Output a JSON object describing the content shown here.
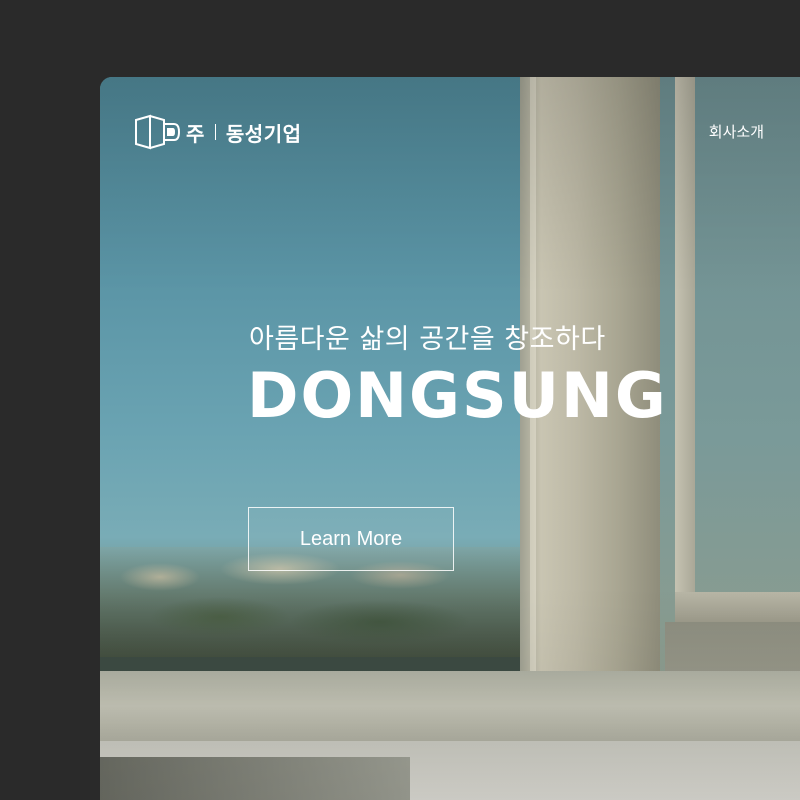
{
  "header": {
    "logo_text": "동성기업",
    "logo_prefix": "주",
    "nav_link": "회사소개"
  },
  "hero": {
    "subtitle": "아름다운 삶의 공간을 창조하다",
    "title": "DONGSUNG",
    "cta_label": "Learn More"
  },
  "colors": {
    "page_background": "#2a2a2a",
    "text": "#ffffff"
  }
}
